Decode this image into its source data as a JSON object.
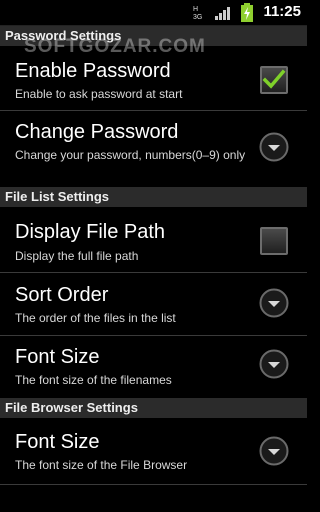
{
  "status_bar": {
    "time": "11:25",
    "icons": [
      "3g-icon",
      "signal-icon",
      "battery-charging-icon"
    ]
  },
  "watermark": "SOFTGOZAR.COM",
  "sections": {
    "password": {
      "header": "Password Settings",
      "enable_password": {
        "title": "Enable Password",
        "summary": "Enable to ask password at start",
        "checked": true
      },
      "change_password": {
        "title": "Change Password",
        "summary": "Change your password, numbers(0–9) only"
      }
    },
    "file_list": {
      "header": "File List Settings",
      "display_file_path": {
        "title": "Display File Path",
        "summary": "Display the full file path",
        "checked": false
      },
      "sort_order": {
        "title": "Sort Order",
        "summary": "The order of the files in the list"
      },
      "font_size": {
        "title": "Font Size",
        "summary": "The font size of the filenames"
      }
    },
    "file_browser": {
      "header": "File Browser Settings",
      "font_size": {
        "title": "Font Size",
        "summary": "The font size of the File Browser"
      }
    }
  },
  "colors": {
    "checkmark": "#7fd12a",
    "header_bg": "#2b2b2b",
    "background": "#000000"
  }
}
